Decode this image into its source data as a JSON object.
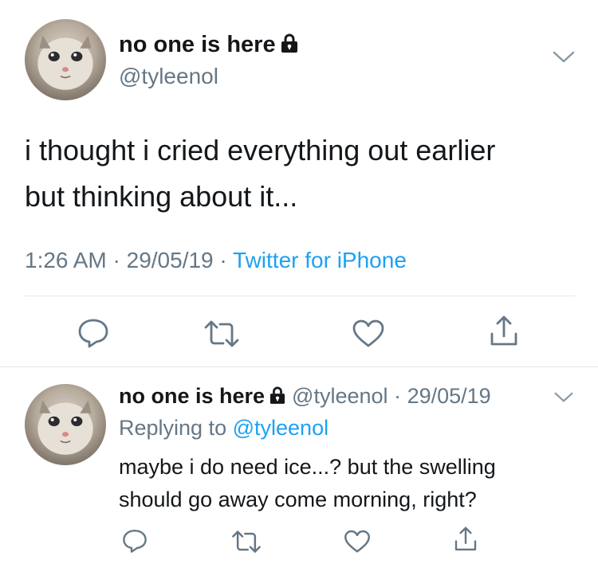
{
  "tweet": {
    "author_name": "no one is here",
    "author_handle": "@tyleenol",
    "text_line1": "i thought i cried everything out earlier",
    "text_line2": "but thinking about it...",
    "time": "1:26 AM",
    "date": "29/05/19",
    "separator": "·",
    "source": "Twitter for iPhone"
  },
  "reply": {
    "author_name": "no one is here",
    "author_handle": "@tyleenol",
    "separator": "·",
    "date": "29/05/19",
    "replying_prefix": "Replying to",
    "replying_mention": "@tyleenol",
    "text_line1": "maybe i do need ice...? but the swelling",
    "text_line2": "should go away come morning, right?"
  },
  "icons": {
    "reply": "comment-icon",
    "retweet": "retweet-icon",
    "like": "heart-icon",
    "share": "share-icon",
    "lock": "lock-icon",
    "more": "chevron-down-icon"
  },
  "colors": {
    "text": "#14171a",
    "secondary": "#657786",
    "link": "#1da1f2",
    "divider": "#e1e8ed",
    "icon": "#657786"
  }
}
